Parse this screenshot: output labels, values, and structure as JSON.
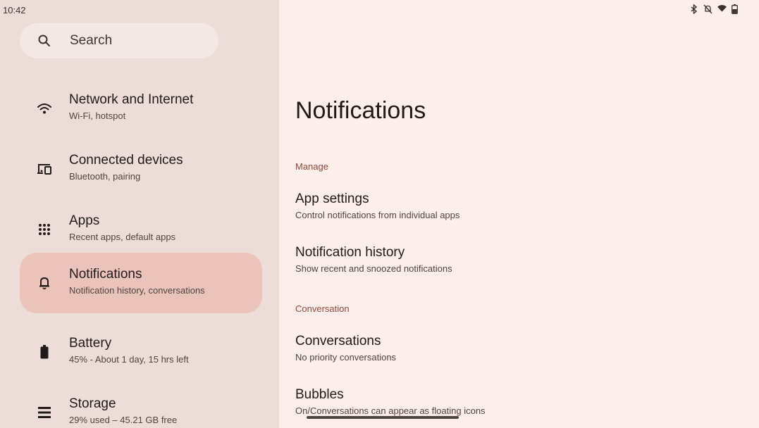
{
  "status_bar": {
    "time": "10:42",
    "icons": [
      "bluetooth-icon",
      "notifications-off-icon",
      "wifi-icon",
      "battery-icon"
    ]
  },
  "search": {
    "label": "Search",
    "icon": "search-icon"
  },
  "sidebar": {
    "items": [
      {
        "title": "Network and Internet",
        "subtitle": "Wi-Fi, hotspot",
        "icon": "wifi-icon",
        "active": false
      },
      {
        "title": "Connected devices",
        "subtitle": "Bluetooth, pairing",
        "icon": "devices-icon",
        "active": false
      },
      {
        "title": "Apps",
        "subtitle": "Recent apps, default apps",
        "icon": "apps-grid-icon",
        "active": false
      },
      {
        "title": "Notifications",
        "subtitle": "Notification history, conversations",
        "icon": "bell-icon",
        "active": true
      },
      {
        "title": "Battery",
        "subtitle": "45% - About 1 day, 15 hrs left",
        "icon": "battery-icon",
        "active": false
      },
      {
        "title": "Storage",
        "subtitle": "29% used – 45.21 GB free",
        "icon": "storage-icon",
        "active": false
      }
    ]
  },
  "main": {
    "title": "Notifications",
    "sections": [
      {
        "header": "Manage",
        "items": [
          {
            "title": "App settings",
            "subtitle": "Control notifications from individual apps"
          },
          {
            "title": "Notification history",
            "subtitle": "Show recent and snoozed notifications"
          }
        ]
      },
      {
        "header": "Conversation",
        "items": [
          {
            "title": "Conversations",
            "subtitle": "No priority conversations"
          },
          {
            "title": "Bubbles",
            "subtitle": "On/Conversations can appear as floating icons"
          }
        ]
      }
    ]
  },
  "colors": {
    "left_pane_bg": "#ecddd9",
    "right_pane_bg": "#fbeeeb",
    "active_item_bg": "#eac4bb",
    "section_header": "#8c4a3c"
  }
}
